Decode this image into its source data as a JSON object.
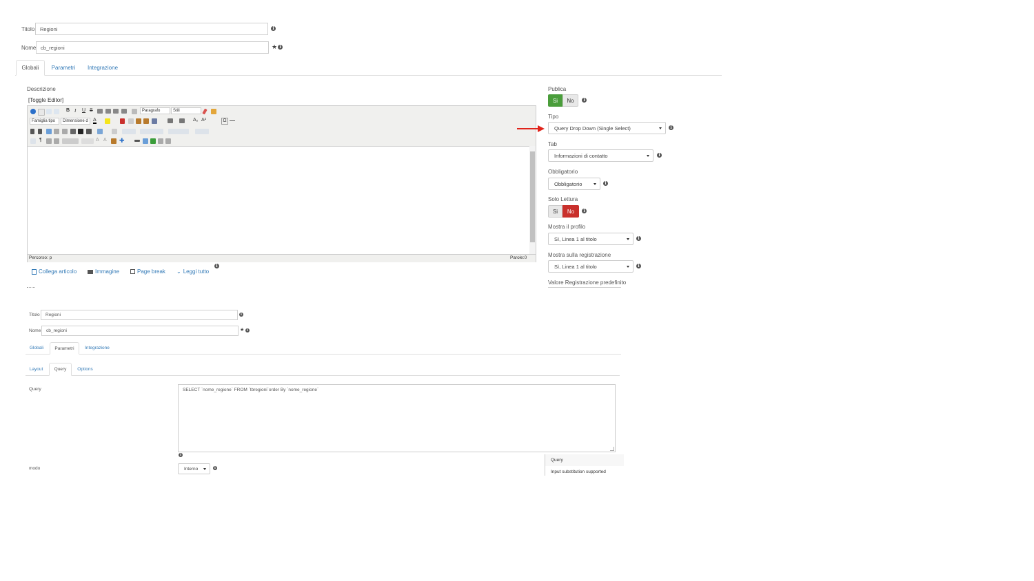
{
  "top": {
    "title_label": "Titolo",
    "title_value": "Regioni",
    "name_label": "Nome",
    "name_value": "cb_regioni"
  },
  "tabs": [
    {
      "label": "Globali"
    },
    {
      "label": "Parametri"
    },
    {
      "label": "Integrazione"
    }
  ],
  "description": {
    "label": "Descrizione",
    "toggle_editor": "[Toggle Editor]",
    "format_select": "Paragrafo",
    "style_select": "Stili",
    "font_family_select": "Famiglia tipo",
    "font_size_select": "Dimensione d",
    "status_path": "Percorso: p",
    "word_count": "Parole:0"
  },
  "editor_buttons": [
    {
      "label": "Collega articolo",
      "icon": "article-icon"
    },
    {
      "label": "Immagine",
      "icon": "image-icon"
    },
    {
      "label": "Page break",
      "icon": "pagebreak-icon"
    },
    {
      "label": "Leggi tutto",
      "icon": "chevron-down-icon"
    }
  ],
  "right": {
    "publish_label": "Publica",
    "publish_yes": "Si",
    "publish_no": "No",
    "type_label": "Tipo",
    "type_value": "Query Drop Down (Single Select)",
    "tab_label": "Tab",
    "tab_value": "Informazioni di contatto",
    "required_label": "Obbligatorio",
    "required_value": "Obbligatorio",
    "readonly_label": "Solo Lettura",
    "readonly_yes": "Si",
    "readonly_no": "No",
    "profile_label": "Mostra il profilo",
    "profile_value": "Sì, Linea 1 al titolo",
    "registration_label": "Mostra sulla registrazione",
    "registration_value": "Sì, Linea 1 al titolo",
    "default_label": "Valore Registrazione predefinito"
  },
  "second": {
    "title_label": "Titolo",
    "title_value": "Regioni",
    "name_label": "Nome",
    "name_value": "cb_regioni",
    "tabs": [
      {
        "label": "Globali"
      },
      {
        "label": "Parametri"
      },
      {
        "label": "Integrazione"
      }
    ],
    "subtabs": [
      {
        "label": "Layout"
      },
      {
        "label": "Query"
      },
      {
        "label": "Options"
      }
    ],
    "query_label": "Query",
    "query_value": "SELECT `nome_regione` FROM `tbregioni`order By `nome_regione`",
    "mode_label": "modo",
    "mode_value": "Interno",
    "tooltip_title": "Query",
    "tooltip_text": "Input substitution supported"
  },
  "colors": {
    "green": "#4a9d3b",
    "red": "#c9302c",
    "link": "#337ab7",
    "arrow": "#e0241b"
  }
}
